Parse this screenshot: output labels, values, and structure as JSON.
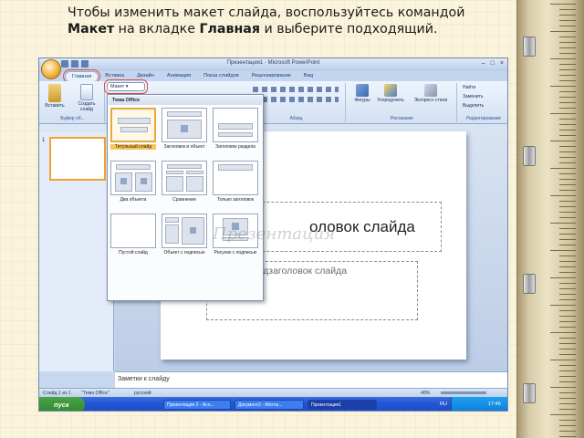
{
  "instruction": {
    "part1": "Чтобы изменить макет слайда, воспользуйтесь командой ",
    "bold1": "Макет",
    "part2": " на вкладке ",
    "bold2": "Главная",
    "part3": " и выберите подходящий."
  },
  "app": {
    "title": "Презентация1 · Microsoft PowerPoint",
    "window_buttons": [
      "–",
      "□",
      "×"
    ]
  },
  "ribbon": {
    "tabs": [
      "Главная",
      "Вставка",
      "Дизайн",
      "Анимация",
      "Показ слайдов",
      "Рецензирование",
      "Вид"
    ],
    "active_tab": "Главная",
    "paste_label": "Вставить",
    "new_slide_label": "Создать слайд",
    "layout_button": "Макет",
    "clipboard_group": "Буфер об...",
    "paragraph_group": "Абзац",
    "drawing_group": "Рисование",
    "editing_group": "Редактирование",
    "shapes_label": "Фигуры",
    "arrange_label": "Упорядочить",
    "quick_styles_label": "Экспресс-стили",
    "find_label": "Найти",
    "replace_label": "Заменить",
    "select_label": "Выделить"
  },
  "gallery": {
    "header": "Тема Office",
    "layouts": [
      "Титульный слайд",
      "Заголовок и объект",
      "Заголовок раздела",
      "Два объекта",
      "Сравнение",
      "Только заголовок",
      "Пустой слайд",
      "Объект с подписью",
      "Рисунок с подписью"
    ],
    "selected": "Титульный слайд"
  },
  "slides_panel": {
    "slide_number": "1"
  },
  "slide": {
    "title_placeholder": "оловок слайда",
    "subtitle_placeholder": "Подзаголовок слайда"
  },
  "notes": {
    "placeholder": "Заметки к слайду"
  },
  "status_bar": {
    "slide_info": "Слайд 1 из 1",
    "theme": "\"Тема Office\"",
    "language": "русский",
    "zoom": "48%"
  },
  "taskbar": {
    "start": "пуск",
    "tasks": [
      "Презентация 2 - Асо...",
      "Документ2 - Micros...",
      "Презентация1"
    ],
    "active_task": "Презентация1",
    "language": "RU",
    "clock": "17:46"
  },
  "watermark": "Презентация"
}
